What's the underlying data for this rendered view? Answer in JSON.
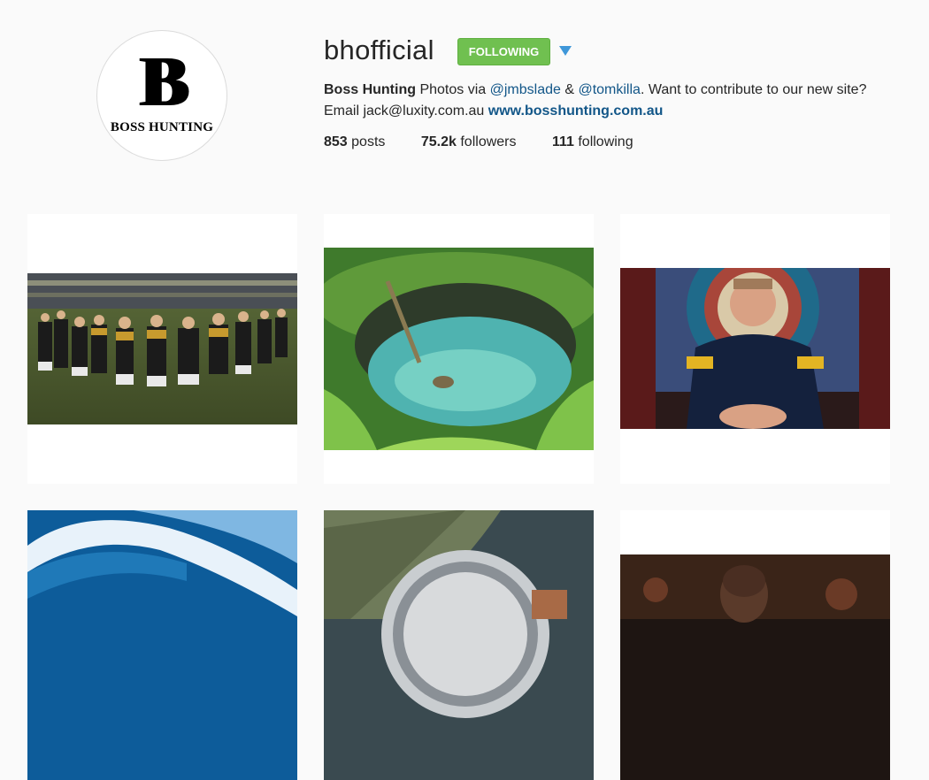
{
  "profile": {
    "username": "bhofficial",
    "follow_label": "FOLLOWING",
    "avatar": {
      "monogram": "B",
      "brand": "BOSS HUNTING"
    },
    "bio": {
      "name": "Boss Hunting",
      "text1": " Photos via ",
      "mention1": "@jmbslade",
      "text2": " & ",
      "mention2": "@tomkilla",
      "text3": ". Want to contribute to our new site?",
      "text4": "Email jack@luxity.com.au ",
      "link": "www.bosshunting.com.au"
    },
    "stats": {
      "posts_count": "853",
      "posts_label": "posts",
      "followers_count": "75.2k",
      "followers_label": "followers",
      "following_count": "111",
      "following_label": "following"
    }
  },
  "colors": {
    "follow_green": "#70c050",
    "link_blue": "#125688",
    "arrow_blue": "#3f97d9"
  },
  "posts": [
    {
      "subject": "football-team-huddle"
    },
    {
      "subject": "sinkhole-swimming-hole"
    },
    {
      "subject": "coach-portrait"
    },
    {
      "subject": "ocean-wave"
    },
    {
      "subject": "wristwatch"
    },
    {
      "subject": "basketball-player"
    }
  ]
}
